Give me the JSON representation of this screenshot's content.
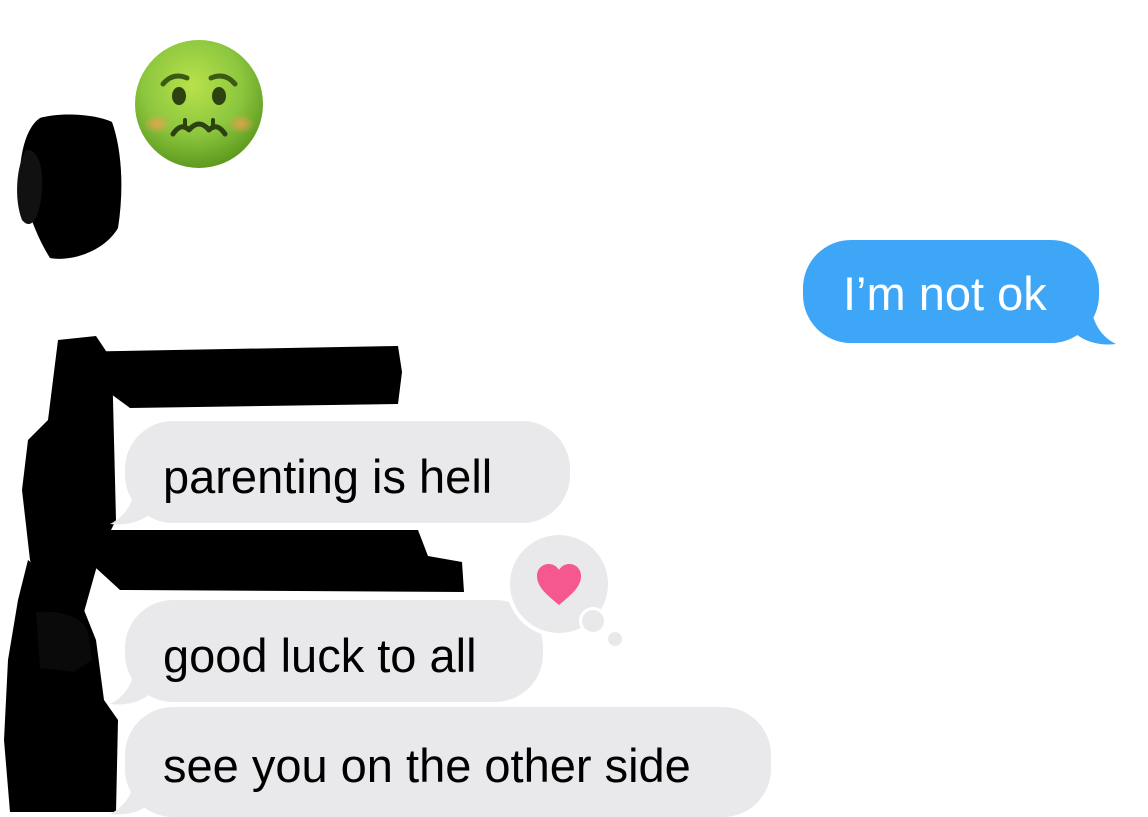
{
  "conversation": {
    "reaction_emoji": "nauseated-face-icon",
    "messages": [
      {
        "direction": "sent",
        "text": "I’m not ok"
      },
      {
        "direction": "received",
        "text": "parenting is hell"
      },
      {
        "direction": "received",
        "text": "good luck to all",
        "tapback": "heart-icon"
      },
      {
        "direction": "received",
        "text": "see you on the other side"
      }
    ]
  },
  "colors": {
    "sent_bubble": "#3ea6f7",
    "received_bubble": "#e9e9eb",
    "heart": "#f5588e",
    "redaction": "#000000"
  }
}
